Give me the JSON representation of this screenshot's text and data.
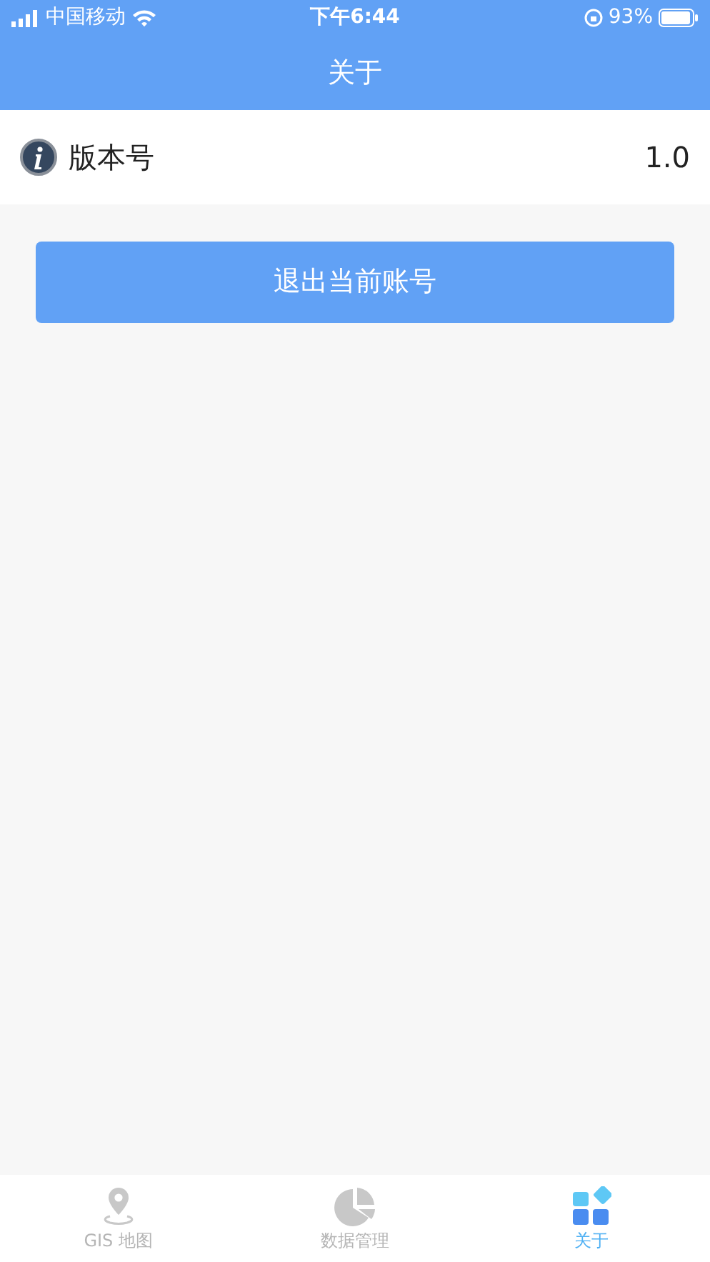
{
  "status_bar": {
    "carrier": "中国移动",
    "time": "下午6:44",
    "battery": "93%"
  },
  "header": {
    "title": "关于"
  },
  "info_row": {
    "label": "版本号",
    "value": "1.0"
  },
  "logout_button": "退出当前账号",
  "tabs": [
    {
      "label": "GIS 地图",
      "kind": "pin",
      "selected": false
    },
    {
      "label": "数据管理",
      "kind": "pie",
      "selected": false
    },
    {
      "label": "关于",
      "kind": "grid",
      "selected": true
    }
  ]
}
